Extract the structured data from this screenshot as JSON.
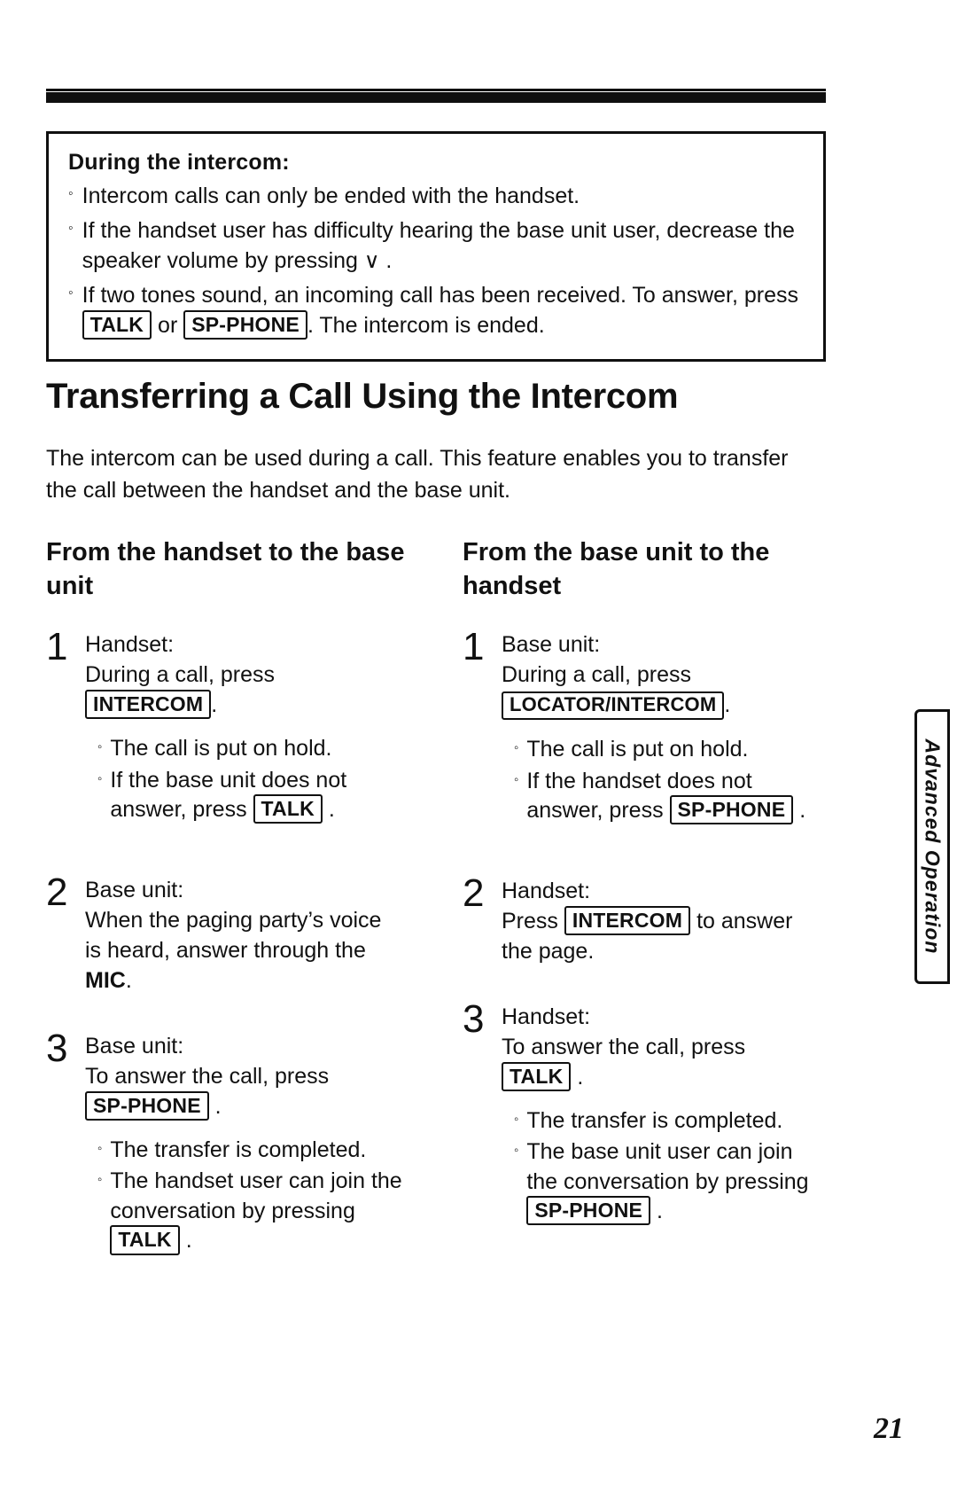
{
  "note": {
    "title": "During the intercom:",
    "bullets": [
      {
        "parts": [
          {
            "t": "text",
            "v": "Intercom calls can only be ended with the handset."
          }
        ]
      },
      {
        "parts": [
          {
            "t": "text",
            "v": "If the handset user has difficulty hearing the base unit user, decrease the speaker volume by pressing "
          },
          {
            "t": "glyph",
            "v": "∨"
          },
          {
            "t": "text",
            "v": " ."
          }
        ]
      },
      {
        "parts": [
          {
            "t": "text",
            "v": "If two tones sound, an incoming call has been received. To answer, press "
          },
          {
            "t": "key",
            "v": "TALK"
          },
          {
            "t": "text",
            "v": " or "
          },
          {
            "t": "key",
            "v": "SP-PHONE"
          },
          {
            "t": "text",
            "v": ". The intercom is ended."
          }
        ]
      }
    ]
  },
  "heading": "Transferring a Call Using the Intercom",
  "intro": "The intercom can be used during a call. This feature enables you to transfer the call between the handset and the base unit.",
  "left_column": {
    "heading": "From the handset to the base unit",
    "steps": [
      {
        "number": "1",
        "lines": [
          {
            "parts": [
              {
                "t": "text",
                "v": "Handset:"
              }
            ]
          },
          {
            "parts": [
              {
                "t": "text",
                "v": "During a call, press"
              }
            ]
          },
          {
            "parts": [
              {
                "t": "key",
                "v": "INTERCOM"
              },
              {
                "t": "text",
                "v": "."
              }
            ]
          }
        ],
        "bullets": [
          {
            "parts": [
              {
                "t": "text",
                "v": "The call is put on hold."
              }
            ]
          },
          {
            "parts": [
              {
                "t": "text",
                "v": "If the base unit does not answer, press "
              },
              {
                "t": "key",
                "v": "TALK"
              },
              {
                "t": "text",
                "v": " ."
              }
            ]
          }
        ]
      },
      {
        "number": "2",
        "lines": [
          {
            "parts": [
              {
                "t": "text",
                "v": "Base unit:"
              }
            ]
          },
          {
            "parts": [
              {
                "t": "text",
                "v": "When the paging party’s voice"
              }
            ]
          },
          {
            "parts": [
              {
                "t": "text",
                "v": "is heard, answer through the"
              }
            ]
          },
          {
            "parts": [
              {
                "t": "bold",
                "v": "MIC"
              },
              {
                "t": "text",
                "v": "."
              }
            ]
          }
        ],
        "bullets": []
      },
      {
        "number": "3",
        "lines": [
          {
            "parts": [
              {
                "t": "text",
                "v": "Base unit:"
              }
            ]
          },
          {
            "parts": [
              {
                "t": "text",
                "v": "To answer the call, press"
              }
            ]
          },
          {
            "parts": [
              {
                "t": "key",
                "v": "SP-PHONE"
              },
              {
                "t": "text",
                "v": " ."
              }
            ]
          }
        ],
        "bullets": [
          {
            "parts": [
              {
                "t": "text",
                "v": "The transfer is completed."
              }
            ]
          },
          {
            "parts": [
              {
                "t": "text",
                "v": "The handset user can join the conversation by pressing "
              },
              {
                "t": "key",
                "v": "TALK"
              },
              {
                "t": "text",
                "v": " ."
              }
            ]
          }
        ]
      }
    ]
  },
  "right_column": {
    "heading": "From the base unit to the handset",
    "steps": [
      {
        "number": "1",
        "lines": [
          {
            "parts": [
              {
                "t": "text",
                "v": "Base unit:"
              }
            ]
          },
          {
            "parts": [
              {
                "t": "text",
                "v": "During a call, press"
              }
            ]
          },
          {
            "parts": [
              {
                "t": "key",
                "v": "LOCATOR/INTERCOM"
              },
              {
                "t": "text",
                "v": "."
              }
            ]
          }
        ],
        "bullets": [
          {
            "parts": [
              {
                "t": "text",
                "v": "The call is put on hold."
              }
            ]
          },
          {
            "parts": [
              {
                "t": "text",
                "v": "If the handset does not answer, press "
              },
              {
                "t": "key",
                "v": "SP-PHONE"
              },
              {
                "t": "text",
                "v": " ."
              }
            ]
          }
        ]
      },
      {
        "number": "2",
        "lines": [
          {
            "parts": [
              {
                "t": "text",
                "v": "Handset:"
              }
            ]
          },
          {
            "parts": [
              {
                "t": "text",
                "v": "Press "
              },
              {
                "t": "key",
                "v": "INTERCOM"
              },
              {
                "t": "text",
                "v": " to answer"
              }
            ]
          },
          {
            "parts": [
              {
                "t": "text",
                "v": "the page."
              }
            ]
          }
        ],
        "bullets": []
      },
      {
        "number": "3",
        "lines": [
          {
            "parts": [
              {
                "t": "text",
                "v": "Handset:"
              }
            ]
          },
          {
            "parts": [
              {
                "t": "text",
                "v": "To answer the call, press"
              }
            ]
          },
          {
            "parts": [
              {
                "t": "key",
                "v": "TALK"
              },
              {
                "t": "text",
                "v": " ."
              }
            ]
          }
        ],
        "bullets": [
          {
            "parts": [
              {
                "t": "text",
                "v": "The transfer is completed."
              }
            ]
          },
          {
            "parts": [
              {
                "t": "text",
                "v": "The base unit user can join the conversation by pressing "
              },
              {
                "t": "key",
                "v": "SP-PHONE"
              },
              {
                "t": "text",
                "v": " ."
              }
            ]
          }
        ]
      }
    ]
  },
  "side_tab": "Advanced Operation",
  "page_number": "21"
}
